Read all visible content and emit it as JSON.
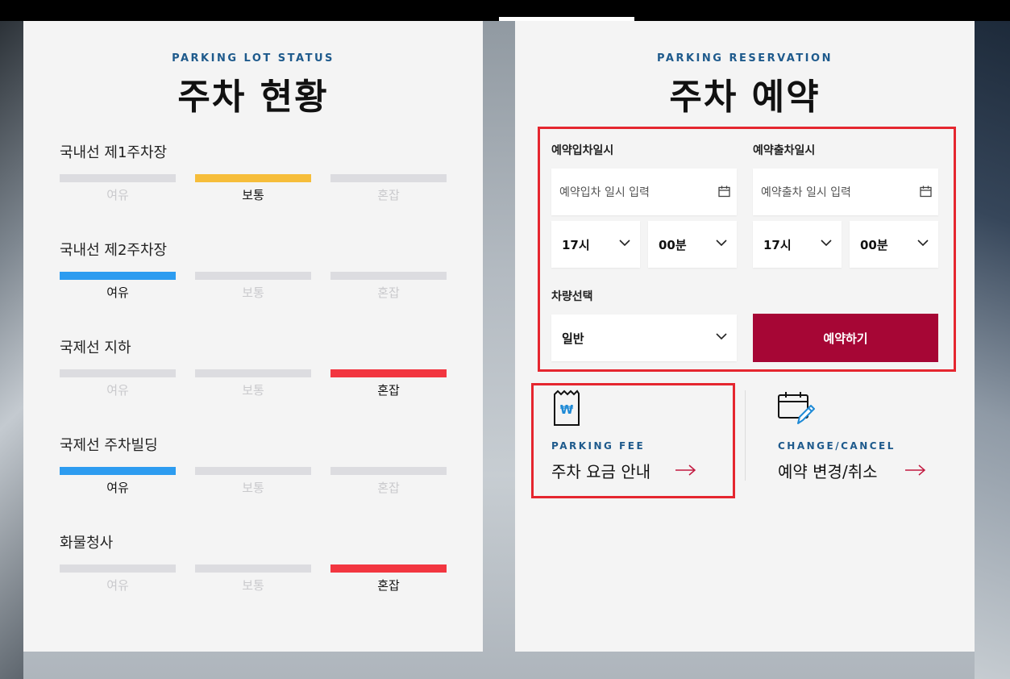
{
  "status_panel": {
    "eyebrow": "PARKING LOT STATUS",
    "title": "주차 현황",
    "levels": [
      "여유",
      "보통",
      "혼잡"
    ],
    "lots": [
      {
        "name": "국내선 제1주차장",
        "status": "보통"
      },
      {
        "name": "국내선 제2주차장",
        "status": "여유"
      },
      {
        "name": "국제선 지하",
        "status": "혼잡"
      },
      {
        "name": "국제선 주차빌딩",
        "status": "여유"
      },
      {
        "name": "화물청사",
        "status": "혼잡"
      }
    ],
    "colors": {
      "good": "#2d9cf0",
      "normal": "#f6bd3a",
      "busy": "#f23640",
      "inactive": "#dcdce0"
    }
  },
  "reservation_panel": {
    "eyebrow": "PARKING RESERVATION",
    "title": "주차 예약",
    "entry": {
      "label": "예약입차일시",
      "placeholder": "예약입차 일시 입력",
      "hour": "17시",
      "minute": "00분"
    },
    "exit": {
      "label": "예약출차일시",
      "placeholder": "예약출차 일시 입력",
      "hour": "17시",
      "minute": "00분"
    },
    "vehicle": {
      "label": "차량선택",
      "value": "일반"
    },
    "reserve_button": "예약하기",
    "accent_color": "#a60635"
  },
  "links": {
    "fee": {
      "eyebrow": "PARKING FEE",
      "title": "주차 요금 안내",
      "icon": "receipt-won-icon"
    },
    "change": {
      "eyebrow": "CHANGE/CANCEL",
      "title": "예약 변경/취소",
      "icon": "calendar-edit-icon"
    }
  }
}
